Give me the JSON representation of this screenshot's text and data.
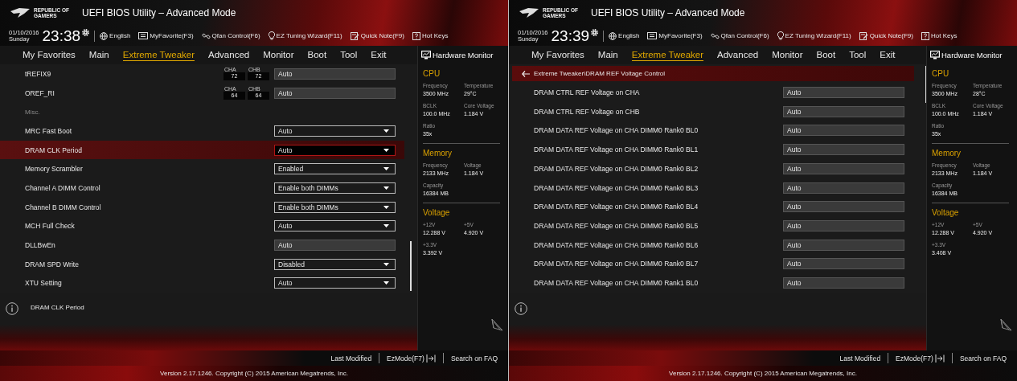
{
  "panels": [
    {
      "logo_text": "REPUBLIC OF GAMERS",
      "title": "UEFI BIOS Utility – Advanced Mode",
      "date": "01/10/2016",
      "day": "Sunday",
      "time": "23:38",
      "toolbar": [
        "English",
        "MyFavorite(F3)",
        "Qfan Control(F6)",
        "EZ Tuning Wizard(F11)",
        "Quick Note(F9)",
        "Hot Keys"
      ],
      "tabs": [
        {
          "label": "My Favorites",
          "selected": false
        },
        {
          "label": "Main",
          "selected": false
        },
        {
          "label": "Extreme Tweaker",
          "selected": true
        },
        {
          "label": "Advanced",
          "selected": false
        },
        {
          "label": "Monitor",
          "selected": false
        },
        {
          "label": "Boot",
          "selected": false
        },
        {
          "label": "Tool",
          "selected": false
        },
        {
          "label": "Exit",
          "selected": false
        }
      ],
      "rows": [
        {
          "kind": "timing",
          "label": "tREFIX9",
          "channels": [
            {
              "label": "CHA",
              "value": "72"
            },
            {
              "label": "CHB",
              "value": "72"
            }
          ],
          "value": "Auto",
          "selected": false
        },
        {
          "kind": "timing",
          "label": "OREF_RI",
          "channels": [
            {
              "label": "CHA",
              "value": "64"
            },
            {
              "label": "CHB",
              "value": "64"
            }
          ],
          "value": "Auto",
          "selected": false
        },
        {
          "kind": "section",
          "label": "Misc.",
          "selected": false
        },
        {
          "kind": "dropdown",
          "label": "MRC Fast Boot",
          "value": "Auto",
          "selected": false
        },
        {
          "kind": "dropdown",
          "label": "DRAM CLK Period",
          "value": "Auto",
          "selected": true
        },
        {
          "kind": "dropdown",
          "label": "Memory Scrambler",
          "value": "Enabled",
          "selected": false
        },
        {
          "kind": "dropdown",
          "label": "Channel A DIMM Control",
          "value": "Enable both DIMMs",
          "selected": false
        },
        {
          "kind": "dropdown",
          "label": "Channel B DIMM Control",
          "value": "Enable both DIMMs",
          "selected": false
        },
        {
          "kind": "dropdown",
          "label": "MCH Full Check",
          "value": "Auto",
          "selected": false
        },
        {
          "kind": "field",
          "label": "DLLBwEn",
          "value": "Auto",
          "selected": false
        },
        {
          "kind": "dropdown",
          "label": "DRAM SPD Write",
          "value": "Disabled",
          "selected": false
        },
        {
          "kind": "dropdown",
          "label": "XTU Setting",
          "value": "Auto",
          "selected": false
        }
      ],
      "info_text": "DRAM CLK Period",
      "monitor": {
        "title": "Hardware Monitor",
        "sections": [
          {
            "title": "CPU",
            "items": [
              {
                "label": "Frequency",
                "value": "3500 MHz"
              },
              {
                "label": "Temperature",
                "value": "29°C"
              },
              {
                "label": "BCLK",
                "value": "100.0 MHz"
              },
              {
                "label": "Core Voltage",
                "value": "1.184 V"
              },
              {
                "label": "Ratio",
                "value": "35x"
              }
            ]
          },
          {
            "title": "Memory",
            "items": [
              {
                "label": "Frequency",
                "value": "2133 MHz"
              },
              {
                "label": "Voltage",
                "value": "1.184 V"
              },
              {
                "label": "Capacity",
                "value": "16384 MB"
              }
            ]
          },
          {
            "title": "Voltage",
            "items": [
              {
                "label": "+12V",
                "value": "12.288 V"
              },
              {
                "label": "+5V",
                "value": "4.920 V"
              },
              {
                "label": "+3.3V",
                "value": "3.392 V"
              }
            ]
          }
        ]
      },
      "footer": [
        "Last Modified",
        "EzMode(F7)",
        "Search on FAQ"
      ],
      "version": "Version 2.17.1246. Copyright (C) 2015 American Megatrends, Inc."
    },
    {
      "logo_text": "REPUBLIC OF GAMERS",
      "title": "UEFI BIOS Utility – Advanced Mode",
      "date": "01/10/2016",
      "day": "Sunday",
      "time": "23:39",
      "toolbar": [
        "English",
        "MyFavorite(F3)",
        "Qfan Control(F6)",
        "EZ Tuning Wizard(F11)",
        "Quick Note(F9)",
        "Hot Keys"
      ],
      "tabs": [
        {
          "label": "My Favorites",
          "selected": false
        },
        {
          "label": "Main",
          "selected": false
        },
        {
          "label": "Extreme Tweaker",
          "selected": true
        },
        {
          "label": "Advanced",
          "selected": false
        },
        {
          "label": "Monitor",
          "selected": false
        },
        {
          "label": "Boot",
          "selected": false
        },
        {
          "label": "Tool",
          "selected": false
        },
        {
          "label": "Exit",
          "selected": false
        }
      ],
      "breadcrumb": "Extreme Tweaker\\DRAM REF Voltage Control",
      "rows": [
        {
          "kind": "field",
          "label": "DRAM CTRL REF Voltage on CHA",
          "value": "Auto",
          "selected": false
        },
        {
          "kind": "field",
          "label": "DRAM CTRL REF Voltage on CHB",
          "value": "Auto",
          "selected": false
        },
        {
          "kind": "field",
          "label": "DRAM DATA REF Voltage on CHA DIMM0 Rank0 BL0",
          "value": "Auto",
          "selected": false
        },
        {
          "kind": "field",
          "label": "DRAM DATA REF Voltage on CHA DIMM0 Rank0 BL1",
          "value": "Auto",
          "selected": false
        },
        {
          "kind": "field",
          "label": "DRAM DATA REF Voltage on CHA DIMM0 Rank0 BL2",
          "value": "Auto",
          "selected": false
        },
        {
          "kind": "field",
          "label": "DRAM DATA REF Voltage on CHA DIMM0 Rank0 BL3",
          "value": "Auto",
          "selected": false
        },
        {
          "kind": "field",
          "label": "DRAM DATA REF Voltage on CHA DIMM0 Rank0 BL4",
          "value": "Auto",
          "selected": false
        },
        {
          "kind": "field",
          "label": "DRAM DATA REF Voltage on CHA DIMM0 Rank0 BL5",
          "value": "Auto",
          "selected": false
        },
        {
          "kind": "field",
          "label": "DRAM DATA REF Voltage on CHA DIMM0 Rank0 BL6",
          "value": "Auto",
          "selected": false
        },
        {
          "kind": "field",
          "label": "DRAM DATA REF Voltage on CHA DIMM0 Rank0 BL7",
          "value": "Auto",
          "selected": false
        },
        {
          "kind": "field",
          "label": "DRAM DATA REF Voltage on CHA DIMM0 Rank1 BL0",
          "value": "Auto",
          "selected": false
        }
      ],
      "monitor": {
        "title": "Hardware Monitor",
        "sections": [
          {
            "title": "CPU",
            "items": [
              {
                "label": "Frequency",
                "value": "3500 MHz"
              },
              {
                "label": "Temperature",
                "value": "28°C"
              },
              {
                "label": "BCLK",
                "value": "100.0 MHz"
              },
              {
                "label": "Core Voltage",
                "value": "1.184 V"
              },
              {
                "label": "Ratio",
                "value": "35x"
              }
            ]
          },
          {
            "title": "Memory",
            "items": [
              {
                "label": "Frequency",
                "value": "2133 MHz"
              },
              {
                "label": "Voltage",
                "value": "1.184 V"
              },
              {
                "label": "Capacity",
                "value": "16384 MB"
              }
            ]
          },
          {
            "title": "Voltage",
            "items": [
              {
                "label": "+12V",
                "value": "12.288 V"
              },
              {
                "label": "+5V",
                "value": "4.920 V"
              },
              {
                "label": "+3.3V",
                "value": "3.408 V"
              }
            ]
          }
        ]
      },
      "footer": [
        "Last Modified",
        "EzMode(F7)",
        "Search on FAQ"
      ],
      "version": "Version 2.17.1246. Copyright (C) 2015 American Megatrends, Inc."
    }
  ]
}
